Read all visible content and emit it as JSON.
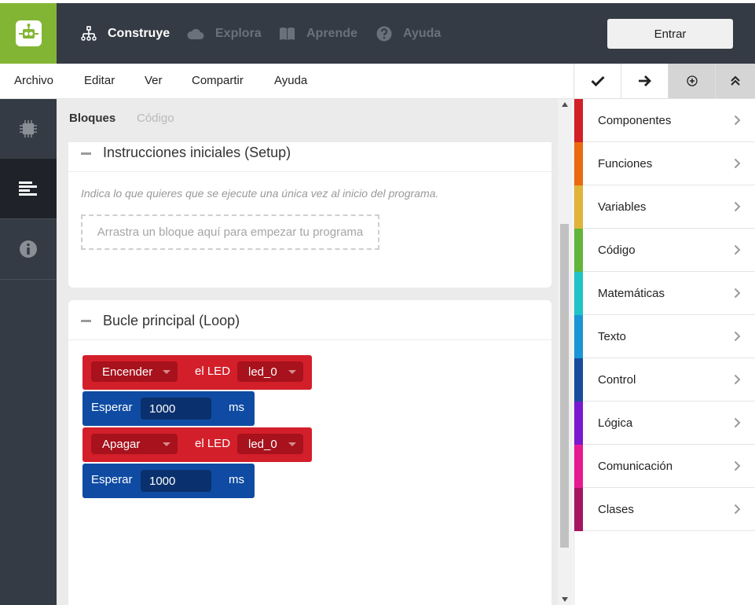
{
  "nav": {
    "items": [
      {
        "label": "Construye",
        "icon": "sitemap-icon",
        "active": true
      },
      {
        "label": "Explora",
        "icon": "cloud-icon",
        "active": false
      },
      {
        "label": "Aprende",
        "icon": "book-icon",
        "active": false
      },
      {
        "label": "Ayuda",
        "icon": "question-circle-icon",
        "active": false
      }
    ],
    "login_label": "Entrar"
  },
  "menu": [
    "Archivo",
    "Editar",
    "Ver",
    "Compartir",
    "Ayuda"
  ],
  "toolbar": [
    {
      "icon": "check-icon"
    },
    {
      "icon": "arrow-right-icon"
    },
    {
      "icon": "plus-circle-icon"
    },
    {
      "icon": "double-chevron-up-icon"
    }
  ],
  "sidebar": [
    {
      "icon": "chip-icon"
    },
    {
      "icon": "align-left-icon"
    },
    {
      "icon": "info-circle-icon"
    }
  ],
  "tabs": {
    "blocks": "Bloques",
    "code": "Código"
  },
  "setup": {
    "title": "Instrucciones iniciales (Setup)",
    "hint": "Indica lo que quieres que se ejecute una única vez al inicio del programa.",
    "dropzone": "Arrastra un bloque aquí para empezar tu programa"
  },
  "loop": {
    "title": "Bucle principal (Loop)",
    "blocks": [
      {
        "type": "led",
        "action": "Encender",
        "label": "el LED",
        "target": "led_0"
      },
      {
        "type": "wait",
        "label": "Esperar",
        "value": "1000",
        "unit": "ms"
      },
      {
        "type": "led",
        "action": "Apagar",
        "label": "el LED",
        "target": "led_0"
      },
      {
        "type": "wait",
        "label": "Esperar",
        "value": "1000",
        "unit": "ms"
      }
    ]
  },
  "palette": [
    {
      "label": "Componentes",
      "color": "#d22027"
    },
    {
      "label": "Funciones",
      "color": "#ea6a0f"
    },
    {
      "label": "Variables",
      "color": "#e0b43a"
    },
    {
      "label": "Código",
      "color": "#62b53a"
    },
    {
      "label": "Matemáticas",
      "color": "#1fc4c8"
    },
    {
      "label": "Texto",
      "color": "#1a96d6"
    },
    {
      "label": "Control",
      "color": "#1a4c9c"
    },
    {
      "label": "Lógica",
      "color": "#7a19cf"
    },
    {
      "label": "Comunicación",
      "color": "#e81a92"
    },
    {
      "label": "Clases",
      "color": "#a51560"
    }
  ]
}
